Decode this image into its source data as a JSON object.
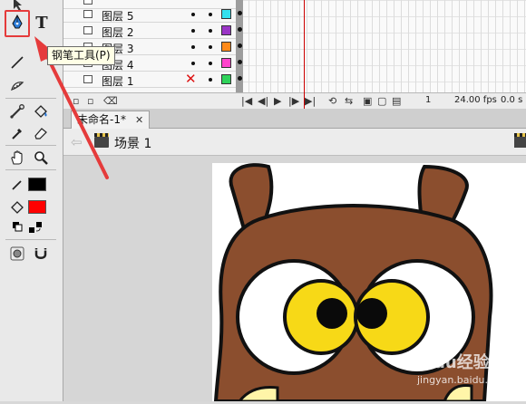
{
  "tooltip": {
    "text": "钢笔工具(P)"
  },
  "toolbar": {
    "text_tool_label": "T",
    "stroke_color": "#000000",
    "fill_color": "#ff0000",
    "highlight_color": "#e53b3b"
  },
  "timeline": {
    "layers": [
      {
        "name": "图层 5",
        "color": "#33e0ee",
        "visible_mark": false
      },
      {
        "name": "图层 2",
        "color": "#9a35c6",
        "visible_mark": false
      },
      {
        "name": "图层 3",
        "color": "#ff8a1a",
        "visible_mark": false
      },
      {
        "name": "图层 4",
        "color": "#ff44cc",
        "visible_mark": false
      },
      {
        "name": "图层 1",
        "color": "#2fd35a",
        "visible_mark": true
      }
    ],
    "current_frame": "1",
    "fps": "24.00 fps",
    "time": "0.0 s"
  },
  "document": {
    "tab_title": "未命名-1*",
    "tab_close": "✕",
    "scene_label": "场景 1"
  },
  "watermark": {
    "brand": "Baidu经验",
    "url": "jingyan.baidu.com"
  }
}
